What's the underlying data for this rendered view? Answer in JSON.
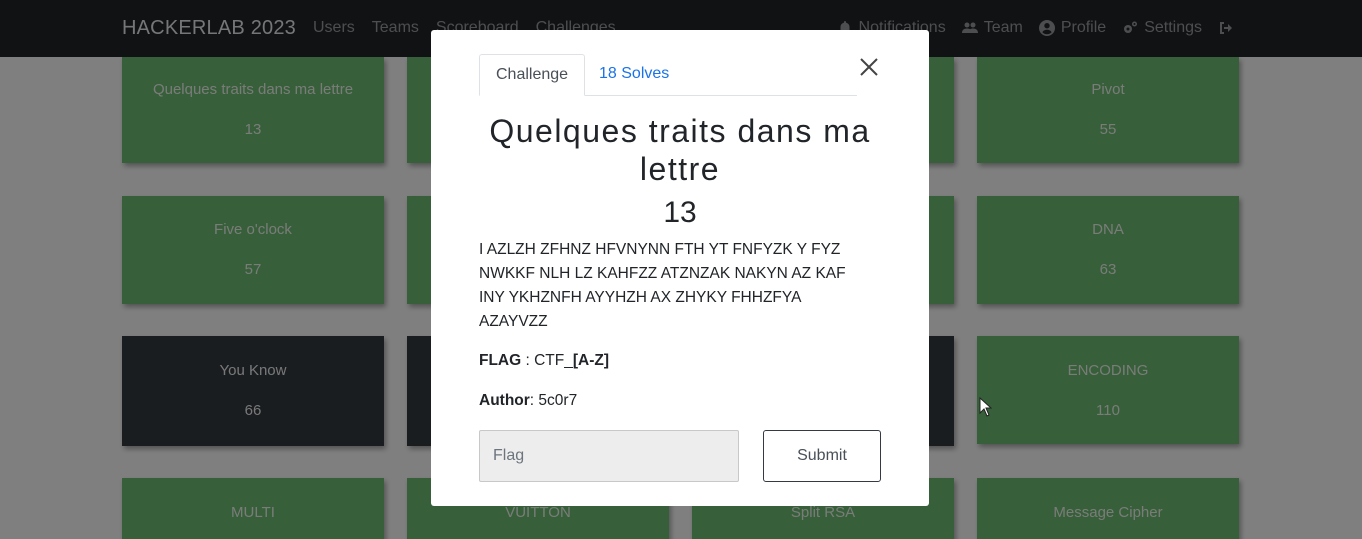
{
  "navbar": {
    "brand": "HACKERLAB 2023",
    "left_links": [
      "Users",
      "Teams",
      "Scoreboard",
      "Challenges"
    ],
    "right_links": [
      {
        "icon": "bell-icon",
        "label": "Notifications"
      },
      {
        "icon": "users-icon",
        "label": "Team"
      },
      {
        "icon": "user-circle-icon",
        "label": "Profile"
      },
      {
        "icon": "gears-icon",
        "label": "Settings"
      },
      {
        "icon": "logout-icon",
        "label": ""
      }
    ]
  },
  "challenges": {
    "row1": [
      {
        "name": "Quelques traits dans ma lettre",
        "value": "13"
      },
      {
        "name": "Pivot",
        "value": "55"
      }
    ],
    "row2": [
      {
        "name": "Five o'clock",
        "value": "57"
      },
      {
        "name": "DNA",
        "value": "63"
      }
    ],
    "row3": [
      {
        "name": "You Know",
        "value": "66"
      },
      {
        "name": "ENCODING",
        "value": "110"
      }
    ],
    "row4": [
      {
        "name": "MULTI"
      },
      {
        "name": "VUITTON"
      },
      {
        "name": "Split RSA"
      },
      {
        "name": "Message Cipher"
      }
    ]
  },
  "modal": {
    "tabs": {
      "challenge": "Challenge",
      "solves": "18 Solves"
    },
    "title": "Quelques traits dans ma lettre",
    "points": "13",
    "description": "I AZLZH ZFHNZ HFVNYNN FTH YT FNFYZK Y FYZ NWKKF NLH LZ KAHFZZ ATZNZAK NAKYN AZ KAF INY YKHZNFH AYYHZH AX ZHYKY FHHZFYA AZAYVZZ",
    "flag_label": "FLAG",
    "flag_sep": " : CTF_",
    "flag_format": "[A-Z]",
    "author_label": "Author",
    "author_sep": ": ",
    "author_value": "5c0r7",
    "flag_placeholder": "Flag",
    "submit_label": "Submit"
  },
  "colors": {
    "navbar": "#212529",
    "solved_card": "#6fbf73",
    "unsolved_card": "#343a40",
    "link": "#1a73e8"
  }
}
